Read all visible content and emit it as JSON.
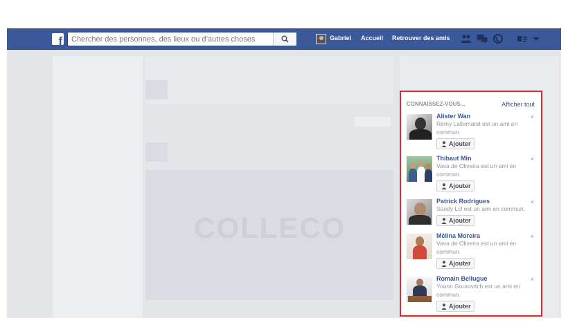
{
  "topbar": {
    "search_placeholder": "Chercher des personnes, des lieux ou d’autres choses",
    "user_name": "Gabriel",
    "home_label": "Accueil",
    "find_friends_label": "Retrouver des amis"
  },
  "background": {
    "watermark_text": "COLLECO"
  },
  "suggestions": {
    "title": "CONNAISSEZ-VOUS...",
    "see_all": "Afficher tout",
    "add_label": "Ajouter",
    "close_glyph": "×",
    "people": [
      {
        "name": "Alister Wan",
        "context": "Rémy Lallemand est un ami en commun."
      },
      {
        "name": "Thibaut Min",
        "context": "Vava de Oliveira est un ami en commun."
      },
      {
        "name": "Patrick Rodrigues",
        "context": "Sandy Lcl est un ami en commun."
      },
      {
        "name": "Mélina Moreira",
        "context": "Vava de Oliveira est un ami en commun."
      },
      {
        "name": "Romain Bellugue",
        "context": "Yoann Gourovitch est un ami en commun."
      }
    ]
  },
  "colors": {
    "brand_blue": "#3b5998",
    "link_blue": "#365899",
    "highlight_red": "#e0282c"
  },
  "icons": [
    "facebook-logo",
    "search-icon",
    "friend-requests-icon",
    "messages-icon",
    "notifications-globe-icon",
    "settings-icon",
    "dropdown-caret-icon",
    "add-friend-icon",
    "close-icon"
  ]
}
